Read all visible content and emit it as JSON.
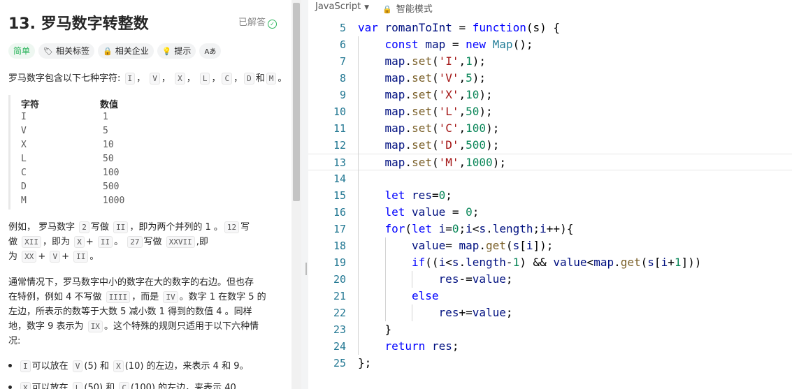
{
  "problem": {
    "title": "13. 罗马数字转整数",
    "status": "已解答",
    "tags": [
      {
        "label": "简单",
        "icon": ""
      },
      {
        "label": "相关标签",
        "icon": "tag-icon"
      },
      {
        "label": "相关企业",
        "icon": "lock-icon"
      },
      {
        "label": "提示",
        "icon": "lightbulb-icon"
      },
      {
        "label": "Aあ",
        "icon": "translate-icon"
      }
    ],
    "intro_text": "罗马数字包含以下七种字符:",
    "intro_chars": [
      "I",
      "V",
      "X",
      "L",
      "C",
      "D",
      "M"
    ],
    "intro_and": "和",
    "intro_end": "。",
    "table": {
      "headers": [
        "字符",
        "数值"
      ],
      "rows": [
        [
          "I",
          "1"
        ],
        [
          "V",
          "5"
        ],
        [
          "X",
          "10"
        ],
        [
          "L",
          "50"
        ],
        [
          "C",
          "100"
        ],
        [
          "D",
          "500"
        ],
        [
          "M",
          "1000"
        ]
      ]
    },
    "p2": {
      "a": "例如， 罗马数字",
      "c1": "2",
      "b": "写做",
      "c2": "II",
      "c": "，即为两个并列的 1 。",
      "c3": "12",
      "d": "写",
      "e": "做",
      "c4": "XII",
      "f": "，即为",
      "c5": "X",
      "g": "+",
      "c6": "II",
      "h": "。",
      "c7": "27",
      "i": "写做",
      "c8": "XXVII",
      "j": ",即",
      "k": "为",
      "c9": "XX",
      "l": "+",
      "c10": "V",
      "m": "+",
      "c11": "II",
      "n": "。"
    },
    "p3": {
      "line1": "通常情况下，罗马数字中小的数字在大的数字的右边。但也存",
      "a": "在特例，例如 4 不写做",
      "c1": "IIII",
      "b": "，而是",
      "c2": "IV",
      "c": "。数字 1 在数字 5 的",
      "line3": "左边，所表示的数等于大数 5 减小数 1 得到的数值 4 。同样",
      "d": "地，数字 9 表示为",
      "c3": "IX",
      "e": "。这个特殊的规则只适用于以下六种情",
      "line5": "况:"
    },
    "bullet1": {
      "c1": "I",
      "a": "可以放在",
      "c2": "V",
      "b": "(5) 和",
      "c3": "X",
      "c": "(10) 的左边，来表示 4 和 9。"
    },
    "bullet2": {
      "c1": "X",
      "a": "可以放在",
      "c2": "L",
      "b": "(50) 和",
      "c3": "C",
      "c": "(100) 的左边，来表示 40"
    }
  },
  "editor": {
    "language": "JavaScript",
    "mode": "智能模式",
    "current_line": 13,
    "colors": {
      "keyword": "#0000ff",
      "identifier": "#001080",
      "string": "#a31515",
      "number": "#098658",
      "function": "#795e26",
      "type": "#267f99",
      "linenumber": "#237893"
    },
    "lines": [
      {
        "num": "5",
        "indent": 0,
        "tokens": [
          [
            "var ",
            "keyword"
          ],
          [
            "romanToInt",
            "identifier"
          ],
          [
            " = ",
            "plain"
          ],
          [
            "function",
            "keyword"
          ],
          [
            "(s) {",
            "plain"
          ]
        ]
      },
      {
        "num": "6",
        "indent": 1,
        "tokens": [
          [
            "const ",
            "keyword"
          ],
          [
            "map",
            "identifier"
          ],
          [
            " = ",
            "plain"
          ],
          [
            "new ",
            "keyword"
          ],
          [
            "Map",
            "type"
          ],
          [
            "();",
            "plain"
          ]
        ]
      },
      {
        "num": "7",
        "indent": 1,
        "tokens": [
          [
            "map",
            "identifier"
          ],
          [
            ".",
            "plain"
          ],
          [
            "set",
            "function"
          ],
          [
            "(",
            "plain"
          ],
          [
            "'I'",
            "string"
          ],
          [
            ",",
            "plain"
          ],
          [
            "1",
            "number"
          ],
          [
            ");",
            "plain"
          ]
        ]
      },
      {
        "num": "8",
        "indent": 1,
        "tokens": [
          [
            "map",
            "identifier"
          ],
          [
            ".",
            "plain"
          ],
          [
            "set",
            "function"
          ],
          [
            "(",
            "plain"
          ],
          [
            "'V'",
            "string"
          ],
          [
            ",",
            "plain"
          ],
          [
            "5",
            "number"
          ],
          [
            ");",
            "plain"
          ]
        ]
      },
      {
        "num": "9",
        "indent": 1,
        "tokens": [
          [
            "map",
            "identifier"
          ],
          [
            ".",
            "plain"
          ],
          [
            "set",
            "function"
          ],
          [
            "(",
            "plain"
          ],
          [
            "'X'",
            "string"
          ],
          [
            ",",
            "plain"
          ],
          [
            "10",
            "number"
          ],
          [
            ");",
            "plain"
          ]
        ]
      },
      {
        "num": "10",
        "indent": 1,
        "tokens": [
          [
            "map",
            "identifier"
          ],
          [
            ".",
            "plain"
          ],
          [
            "set",
            "function"
          ],
          [
            "(",
            "plain"
          ],
          [
            "'L'",
            "string"
          ],
          [
            ",",
            "plain"
          ],
          [
            "50",
            "number"
          ],
          [
            ");",
            "plain"
          ]
        ]
      },
      {
        "num": "11",
        "indent": 1,
        "tokens": [
          [
            "map",
            "identifier"
          ],
          [
            ".",
            "plain"
          ],
          [
            "set",
            "function"
          ],
          [
            "(",
            "plain"
          ],
          [
            "'C'",
            "string"
          ],
          [
            ",",
            "plain"
          ],
          [
            "100",
            "number"
          ],
          [
            ");",
            "plain"
          ]
        ]
      },
      {
        "num": "12",
        "indent": 1,
        "tokens": [
          [
            "map",
            "identifier"
          ],
          [
            ".",
            "plain"
          ],
          [
            "set",
            "function"
          ],
          [
            "(",
            "plain"
          ],
          [
            "'D'",
            "string"
          ],
          [
            ",",
            "plain"
          ],
          [
            "500",
            "number"
          ],
          [
            ");",
            "plain"
          ]
        ]
      },
      {
        "num": "13",
        "indent": 1,
        "tokens": [
          [
            "map",
            "identifier"
          ],
          [
            ".",
            "plain"
          ],
          [
            "set",
            "function"
          ],
          [
            "(",
            "plain"
          ],
          [
            "'M'",
            "string"
          ],
          [
            ",",
            "plain"
          ],
          [
            "1000",
            "number"
          ],
          [
            ");",
            "plain"
          ]
        ]
      },
      {
        "num": "14",
        "indent": 0,
        "tokens": []
      },
      {
        "num": "15",
        "indent": 1,
        "tokens": [
          [
            "let ",
            "keyword"
          ],
          [
            "res",
            "identifier"
          ],
          [
            "=",
            "plain"
          ],
          [
            "0",
            "number"
          ],
          [
            ";",
            "plain"
          ]
        ]
      },
      {
        "num": "16",
        "indent": 1,
        "tokens": [
          [
            "let ",
            "keyword"
          ],
          [
            "value",
            "identifier"
          ],
          [
            " = ",
            "plain"
          ],
          [
            "0",
            "number"
          ],
          [
            ";",
            "plain"
          ]
        ]
      },
      {
        "num": "17",
        "indent": 1,
        "tokens": [
          [
            "for",
            "keyword"
          ],
          [
            "(",
            "plain"
          ],
          [
            "let ",
            "keyword"
          ],
          [
            "i",
            "identifier"
          ],
          [
            "=",
            "plain"
          ],
          [
            "0",
            "number"
          ],
          [
            ";",
            "plain"
          ],
          [
            "i",
            "identifier"
          ],
          [
            "<",
            "plain"
          ],
          [
            "s",
            "identifier"
          ],
          [
            ".",
            "plain"
          ],
          [
            "length",
            "identifier"
          ],
          [
            ";",
            "plain"
          ],
          [
            "i",
            "identifier"
          ],
          [
            "++){",
            "plain"
          ]
        ]
      },
      {
        "num": "18",
        "indent": 2,
        "tokens": [
          [
            "value",
            "identifier"
          ],
          [
            "= ",
            "plain"
          ],
          [
            "map",
            "identifier"
          ],
          [
            ".",
            "plain"
          ],
          [
            "get",
            "function"
          ],
          [
            "(",
            "plain"
          ],
          [
            "s",
            "identifier"
          ],
          [
            "[",
            "plain"
          ],
          [
            "i",
            "identifier"
          ],
          [
            "]);",
            "plain"
          ]
        ]
      },
      {
        "num": "19",
        "indent": 2,
        "tokens": [
          [
            "if",
            "keyword"
          ],
          [
            "((",
            "plain"
          ],
          [
            "i",
            "identifier"
          ],
          [
            "<",
            "plain"
          ],
          [
            "s",
            "identifier"
          ],
          [
            ".",
            "plain"
          ],
          [
            "length",
            "identifier"
          ],
          [
            "-",
            "plain"
          ],
          [
            "1",
            "number"
          ],
          [
            ") && ",
            "plain"
          ],
          [
            "value",
            "identifier"
          ],
          [
            "<",
            "plain"
          ],
          [
            "map",
            "identifier"
          ],
          [
            ".",
            "plain"
          ],
          [
            "get",
            "function"
          ],
          [
            "(",
            "plain"
          ],
          [
            "s",
            "identifier"
          ],
          [
            "[",
            "plain"
          ],
          [
            "i",
            "identifier"
          ],
          [
            "+",
            "plain"
          ],
          [
            "1",
            "number"
          ],
          [
            "]))",
            "plain"
          ]
        ]
      },
      {
        "num": "20",
        "indent": 3,
        "tokens": [
          [
            "res",
            "identifier"
          ],
          [
            "-=",
            "plain"
          ],
          [
            "value",
            "identifier"
          ],
          [
            ";",
            "plain"
          ]
        ]
      },
      {
        "num": "21",
        "indent": 2,
        "tokens": [
          [
            "else",
            "keyword"
          ]
        ]
      },
      {
        "num": "22",
        "indent": 3,
        "tokens": [
          [
            "res",
            "identifier"
          ],
          [
            "+=",
            "plain"
          ],
          [
            "value",
            "identifier"
          ],
          [
            ";",
            "plain"
          ]
        ]
      },
      {
        "num": "23",
        "indent": 1,
        "tokens": [
          [
            "}",
            "plain"
          ]
        ]
      },
      {
        "num": "24",
        "indent": 1,
        "tokens": [
          [
            "return ",
            "keyword"
          ],
          [
            "res",
            "identifier"
          ],
          [
            ";",
            "plain"
          ]
        ]
      },
      {
        "num": "25",
        "indent": 0,
        "tokens": [
          [
            "};",
            "plain"
          ]
        ]
      }
    ]
  }
}
